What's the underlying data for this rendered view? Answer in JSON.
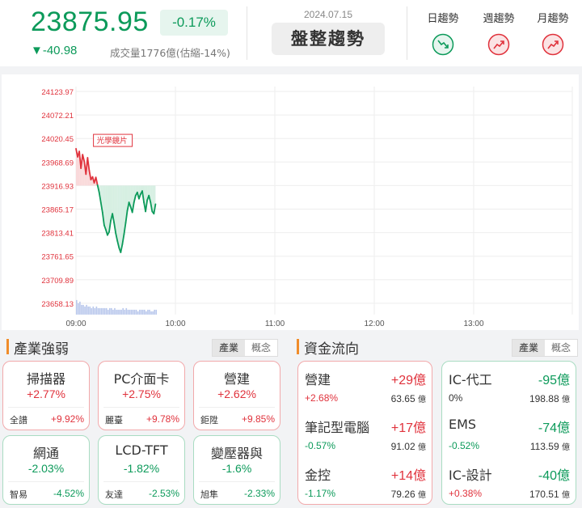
{
  "header": {
    "index_value": "23875.95",
    "change_pct": "-0.17%",
    "change_pts": "▼-40.98",
    "volume_text": "成交量1776億(估縮-14%)",
    "date": "2024.07.15",
    "trend_label": "盤整趨勢",
    "trends": [
      {
        "label": "日趨勢",
        "direction": "down",
        "icon": "trend-down-icon",
        "color": "#0c9a5a"
      },
      {
        "label": "週趨勢",
        "direction": "up",
        "icon": "trend-up-icon",
        "color": "#e0323c"
      },
      {
        "label": "月趨勢",
        "direction": "up",
        "icon": "trend-up-icon",
        "color": "#e0323c"
      }
    ]
  },
  "chart_data": {
    "type": "line",
    "reference_value": 23916.93,
    "y_ticks": [
      "24123.97",
      "24072.21",
      "24020.45",
      "23968.69",
      "23916.93",
      "23865.17",
      "23813.41",
      "23761.65",
      "23709.89",
      "23658.13"
    ],
    "x_ticks": [
      "09:00",
      "10:00",
      "11:00",
      "12:00",
      "13:00"
    ],
    "annotation": "光學鏡片",
    "colors": {
      "up": "#e0323c",
      "down": "#0c9a5a",
      "up_fill": "#f9d9da",
      "down_fill": "#d6efe2",
      "volume": "#b8c7ec"
    },
    "series": [
      {
        "x": [
          "09:00",
          "09:01",
          "09:02",
          "09:03",
          "09:04",
          "09:05",
          "09:06",
          "09:07",
          "09:08",
          "09:09",
          "09:10",
          "09:11",
          "09:12",
          "09:13",
          "09:14",
          "09:15",
          "09:16",
          "09:17",
          "09:18",
          "09:19",
          "09:20",
          "09:21",
          "09:22",
          "09:23",
          "09:24",
          "09:25",
          "09:26",
          "09:27",
          "09:28",
          "09:29",
          "09:30",
          "09:31",
          "09:32",
          "09:33",
          "09:34",
          "09:35",
          "09:36",
          "09:37",
          "09:38",
          "09:39",
          "09:40",
          "09:41",
          "09:42",
          "09:43",
          "09:44",
          "09:45",
          "09:46",
          "09:47",
          "09:48"
        ],
        "values": [
          23998,
          23980,
          23992,
          23955,
          23985,
          23970,
          23942,
          23978,
          23950,
          23930,
          23936,
          23923,
          23935,
          23918,
          23902,
          23880,
          23858,
          23830,
          23820,
          23808,
          23815,
          23840,
          23855,
          23835,
          23812,
          23795,
          23780,
          23770,
          23788,
          23810,
          23835,
          23862,
          23880,
          23870,
          23858,
          23880,
          23895,
          23902,
          23888,
          23898,
          23905,
          23880,
          23860,
          23885,
          23895,
          23880,
          23860,
          23855,
          23876
        ]
      }
    ],
    "volume": [
      9,
      7,
      8,
      6,
      6,
      5,
      6,
      5,
      5,
      4,
      5,
      4,
      5,
      4,
      4,
      4,
      4,
      4,
      4,
      3,
      4,
      4,
      3,
      4,
      3,
      3,
      3,
      3,
      4,
      3,
      4,
      3,
      3,
      3,
      3,
      3,
      3,
      2,
      3,
      3,
      3,
      3,
      2,
      3,
      3,
      2,
      2,
      3,
      3
    ]
  },
  "industry": {
    "title": "產業強弱",
    "tabs": [
      "產業",
      "概念"
    ],
    "cards": [
      {
        "name": "掃描器",
        "pct": "+2.77%",
        "stock": "全譜",
        "stock_pct": "+9.92%",
        "dir": "up"
      },
      {
        "name": "PC介面卡",
        "pct": "+2.75%",
        "stock": "麗臺",
        "stock_pct": "+9.78%",
        "dir": "up"
      },
      {
        "name": "營建",
        "pct": "+2.62%",
        "stock": "鉅陞",
        "stock_pct": "+9.85%",
        "dir": "up"
      },
      {
        "name": "網通",
        "pct": "-2.03%",
        "stock": "智易",
        "stock_pct": "-4.52%",
        "dir": "down"
      },
      {
        "name": "LCD-TFT",
        "pct": "-1.82%",
        "stock": "友達",
        "stock_pct": "-2.53%",
        "dir": "down"
      },
      {
        "name": "變壓器與",
        "pct": "-1.6%",
        "stock": "旭隼",
        "stock_pct": "-2.33%",
        "dir": "down"
      }
    ]
  },
  "flow": {
    "title": "資金流向",
    "tabs": [
      "產業",
      "概念"
    ],
    "unit": "億",
    "inflow": [
      {
        "name": "營建",
        "amount": "+29億",
        "pct": "+2.68%",
        "value": "63.65",
        "pct_dir": "up"
      },
      {
        "name": "筆記型電腦",
        "amount": "+17億",
        "pct": "-0.57%",
        "value": "91.02",
        "pct_dir": "down"
      },
      {
        "name": "金控",
        "amount": "+14億",
        "pct": "-1.17%",
        "value": "79.26",
        "pct_dir": "down"
      }
    ],
    "outflow": [
      {
        "name": "IC-代工",
        "amount": "-95億",
        "pct": "0%",
        "value": "198.88",
        "pct_dir": "flat"
      },
      {
        "name": "EMS",
        "amount": "-74億",
        "pct": "-0.52%",
        "value": "113.59",
        "pct_dir": "down"
      },
      {
        "name": "IC-設計",
        "amount": "-40億",
        "pct": "+0.38%",
        "value": "170.51",
        "pct_dir": "up"
      }
    ]
  }
}
